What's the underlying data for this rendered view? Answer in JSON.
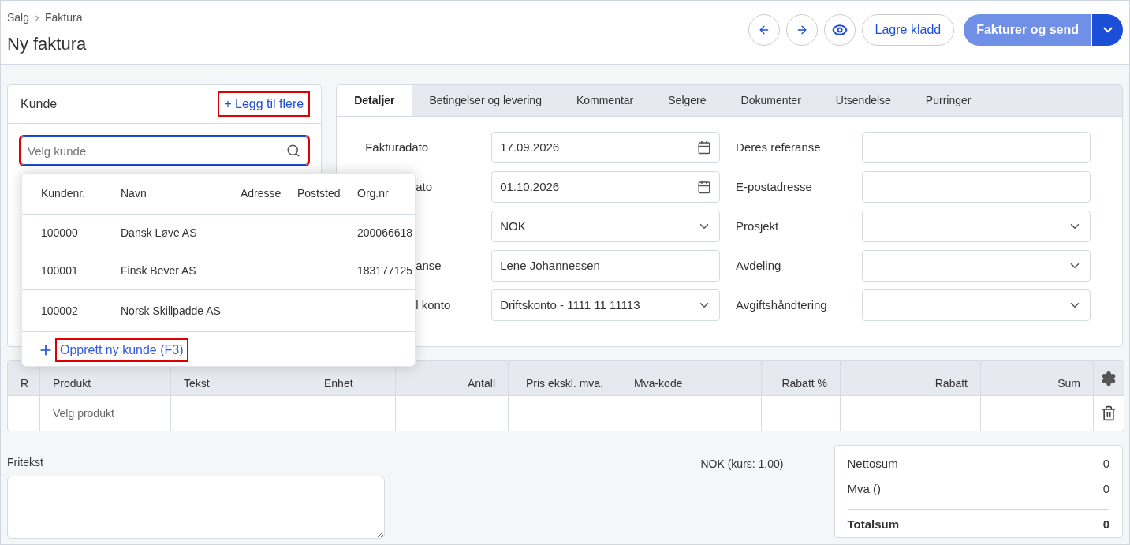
{
  "breadcrumb": [
    {
      "label": "Salg"
    },
    {
      "label": "Faktura"
    }
  ],
  "title": "Ny faktura",
  "header_buttons": {
    "save_draft": "Lagre kladd",
    "primary": "Fakturer og send",
    "primary_disabled": true
  },
  "customer_card": {
    "title": "Kunde",
    "add_more": {
      "label": "+ Legg til flere",
      "highlighted": true
    },
    "search": {
      "placeholder": "Velg kunde",
      "highlighted": true
    }
  },
  "customer_dropdown": {
    "columns": [
      "Kundenr.",
      "Navn",
      "Adresse",
      "Poststed",
      "Org.nr"
    ],
    "rows": [
      [
        "100000",
        "Dansk Løve AS",
        null,
        null,
        "200066618"
      ],
      [
        "100001",
        "Finsk Bever AS",
        null,
        null,
        "183177125"
      ],
      [
        "100002",
        "Norsk Skillpadde AS",
        null,
        null,
        null
      ]
    ],
    "create_link": {
      "label": "Opprett ny kunde (F3)",
      "highlighted": true
    }
  },
  "tabs": [
    {
      "label": "Detaljer",
      "selected": true
    },
    {
      "label": "Betingelser og levering",
      "selected": false
    },
    {
      "label": "Kommentar",
      "selected": false
    },
    {
      "label": "Selgere",
      "selected": false
    },
    {
      "label": "Dokumenter",
      "selected": false
    },
    {
      "label": "Utsendelse",
      "selected": false
    },
    {
      "label": "Purringer",
      "selected": false
    }
  ],
  "form_rows": [
    {
      "left": {
        "label": "Fakturadato",
        "kind": "date",
        "value": "17.09.2026"
      },
      "right": {
        "label": "Deres referanse",
        "kind": "text"
      }
    },
    {
      "left": {
        "label": "ato",
        "cut": true,
        "kind": "date",
        "value": "01.10.2026"
      },
      "right": {
        "label": "E-postadresse",
        "kind": "text"
      }
    },
    {
      "left": {
        "kind": "select",
        "value": "NOK"
      },
      "right": {
        "label": "Prosjekt",
        "kind": "select"
      }
    },
    {
      "left": {
        "label": "anse",
        "cut": true,
        "kind": "text",
        "value": "Lene Johannessen"
      },
      "right": {
        "label": "Avdeling",
        "kind": "select"
      }
    },
    {
      "left": {
        "label": "l konto",
        "cut": true,
        "kind": "select",
        "value": "Driftskonto - 1111 11 11113"
      },
      "right": {
        "label": "Avgiftshåndtering",
        "kind": "select"
      }
    }
  ],
  "lines_table": {
    "columns": [
      "R",
      "Produkt",
      "Tekst",
      "Enhet",
      "Antall",
      "Pris ekskl. mva.",
      "Mva-kode",
      "Rabatt %",
      "Rabatt",
      "Sum"
    ],
    "rows": [
      {
        "product_placeholder": "Velg produkt"
      }
    ]
  },
  "free_text": {
    "label": "Fritekst"
  },
  "currency_note": "NOK (kurs: 1,00)",
  "totals": [
    {
      "label": "Nettosum",
      "value": "0",
      "bold": false
    },
    {
      "label": "Mva ()",
      "value": "0",
      "bold": false
    },
    {
      "label": "Totalsum",
      "value": "0",
      "bold": true
    }
  ]
}
